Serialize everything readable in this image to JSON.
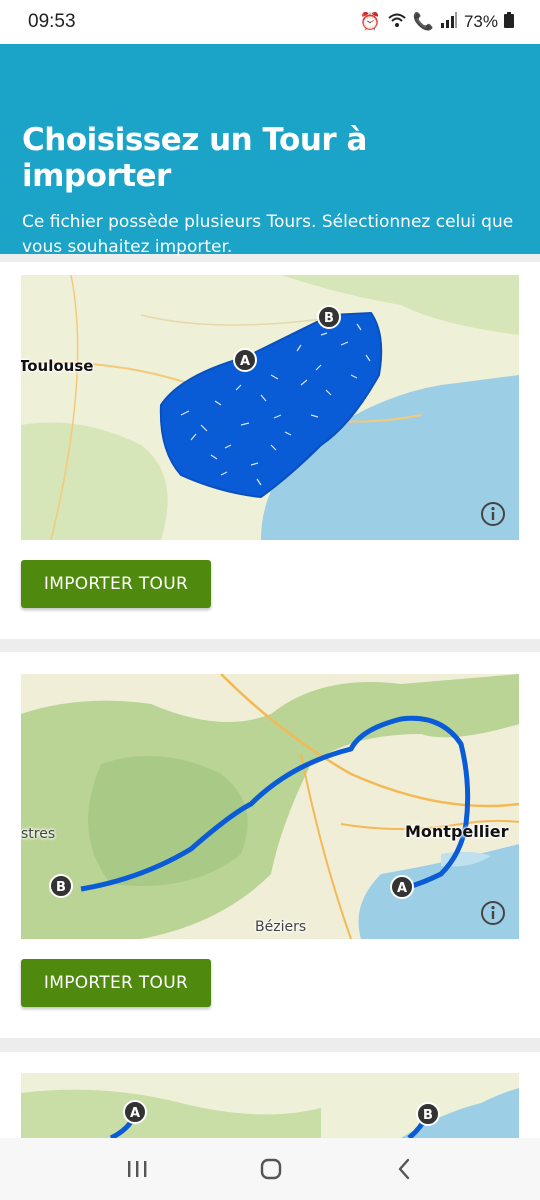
{
  "status_bar": {
    "time": "09:53",
    "battery": "73%"
  },
  "header": {
    "title": "Choisissez un Tour à importer",
    "subtitle": "Ce fichier possède plusieurs Tours. Sélectionnez celui que vous souhaitez importer."
  },
  "tours": [
    {
      "map_labels": {
        "city": "Toulouse"
      },
      "markers": {
        "start": "A",
        "end": "B"
      },
      "button_label": "IMPORTER TOUR"
    },
    {
      "map_labels": {
        "city": "Montpellier",
        "town": "Béziers",
        "partial": "stres"
      },
      "markers": {
        "start": "A",
        "end": "B"
      },
      "button_label": "IMPORTER TOUR"
    },
    {
      "markers": {
        "start": "A",
        "end": "B"
      }
    }
  ],
  "colors": {
    "header_bg": "#1ba3c8",
    "button_bg": "#4f8a0e",
    "route": "#0a5bd6",
    "sea": "#9ccfe6"
  }
}
